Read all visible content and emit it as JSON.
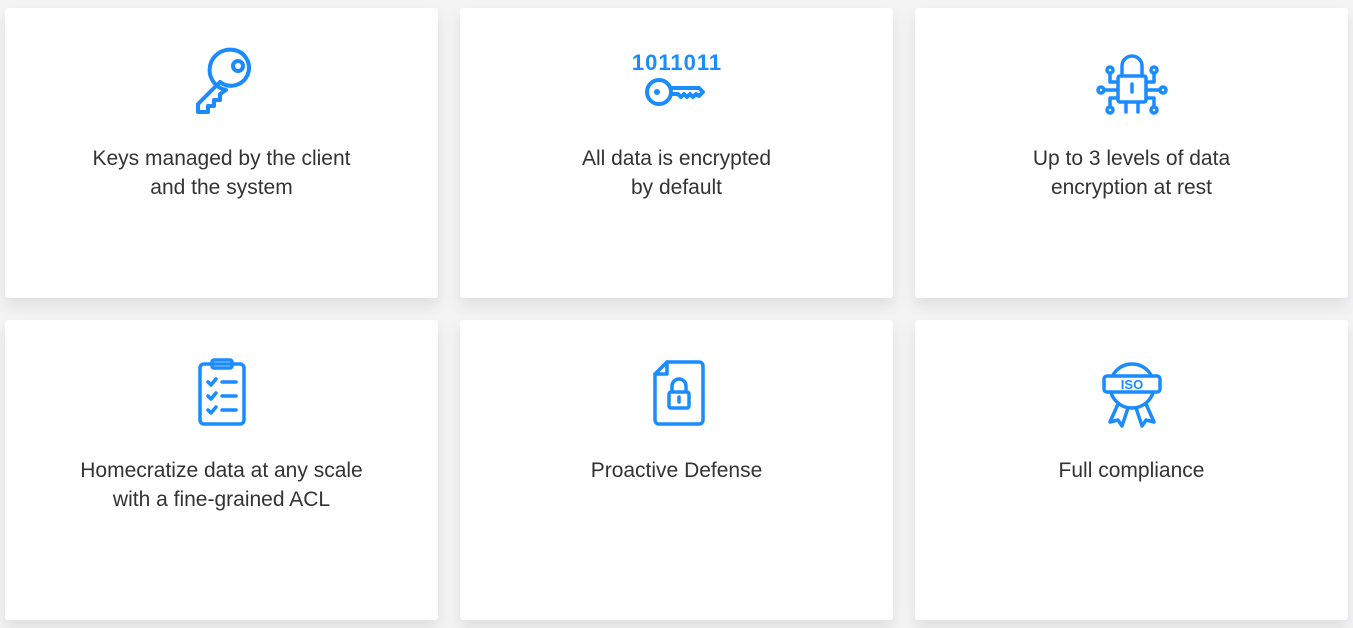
{
  "accent_color": "#1a8cff",
  "cards": [
    {
      "icon": "key-icon",
      "lines": [
        "Keys managed by the client",
        "and the system"
      ]
    },
    {
      "icon": "binary-key-icon",
      "binary_text": "1011011",
      "lines": [
        "All data is encrypted",
        "by default"
      ]
    },
    {
      "icon": "circuit-lock-icon",
      "lines": [
        "Up to 3 levels of data",
        "encryption at rest"
      ]
    },
    {
      "icon": "checklist-icon",
      "lines": [
        "Homecratize data at any scale",
        "with a fine-grained ACL"
      ]
    },
    {
      "icon": "document-lock-icon",
      "lines": [
        "Proactive Defense"
      ]
    },
    {
      "icon": "iso-badge-icon",
      "badge_text": "ISO",
      "lines": [
        "Full compliance"
      ]
    }
  ]
}
